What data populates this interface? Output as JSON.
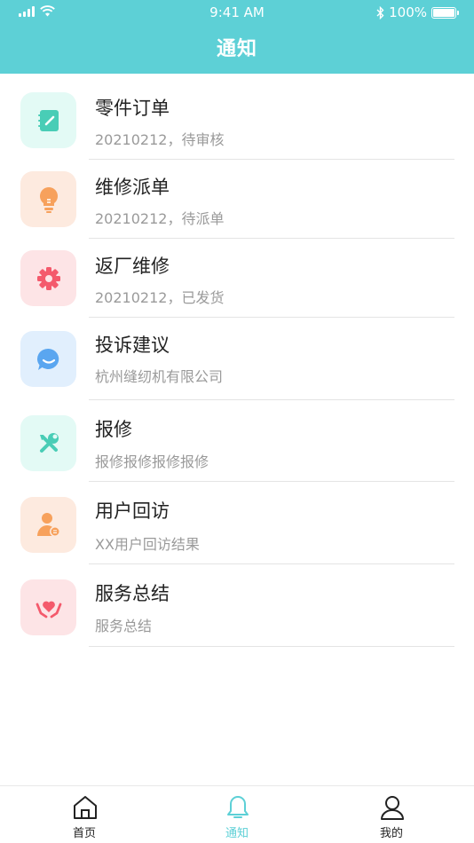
{
  "status_bar": {
    "time": "9:41 AM",
    "battery": "100%"
  },
  "header": {
    "title": "通知"
  },
  "notifications": [
    {
      "title": "零件订单",
      "subtitle": "20210212，待审核",
      "icon": "notebook-icon",
      "bg": "#e3faf5",
      "color": "#49cdb6"
    },
    {
      "title": "维修派单",
      "subtitle": "20210212，待派单",
      "icon": "lightbulb-icon",
      "bg": "#fdeadf",
      "color": "#f7a15c"
    },
    {
      "title": "返厂维修",
      "subtitle": "20210212，已发货",
      "icon": "gear-icon",
      "bg": "#fde4e6",
      "color": "#f45a6c"
    },
    {
      "title": "投诉建议",
      "subtitle": "杭州缝纫机有限公司",
      "icon": "chat-bubble-icon",
      "bg": "#e1effd",
      "color": "#5aa6f0"
    },
    {
      "title": "报修",
      "subtitle": "报修报修报修报修",
      "icon": "tools-icon",
      "bg": "#e3faf5",
      "color": "#49cdb6"
    },
    {
      "title": "用户回访",
      "subtitle": "XX用户回访结果",
      "icon": "user-visit-icon",
      "bg": "#fdeadf",
      "color": "#f7a15c"
    },
    {
      "title": "服务总结",
      "subtitle": "服务总结",
      "icon": "heart-hands-icon",
      "bg": "#fde4e6",
      "color": "#f45a6c"
    }
  ],
  "tabbar": {
    "tabs": [
      {
        "label": "首页",
        "icon": "home-icon"
      },
      {
        "label": "通知",
        "icon": "bell-icon",
        "active": true
      },
      {
        "label": "我的",
        "icon": "profile-icon"
      }
    ],
    "accent": "#5dd0d6"
  },
  "colors": {
    "header_bg": "#5dd0d6"
  }
}
